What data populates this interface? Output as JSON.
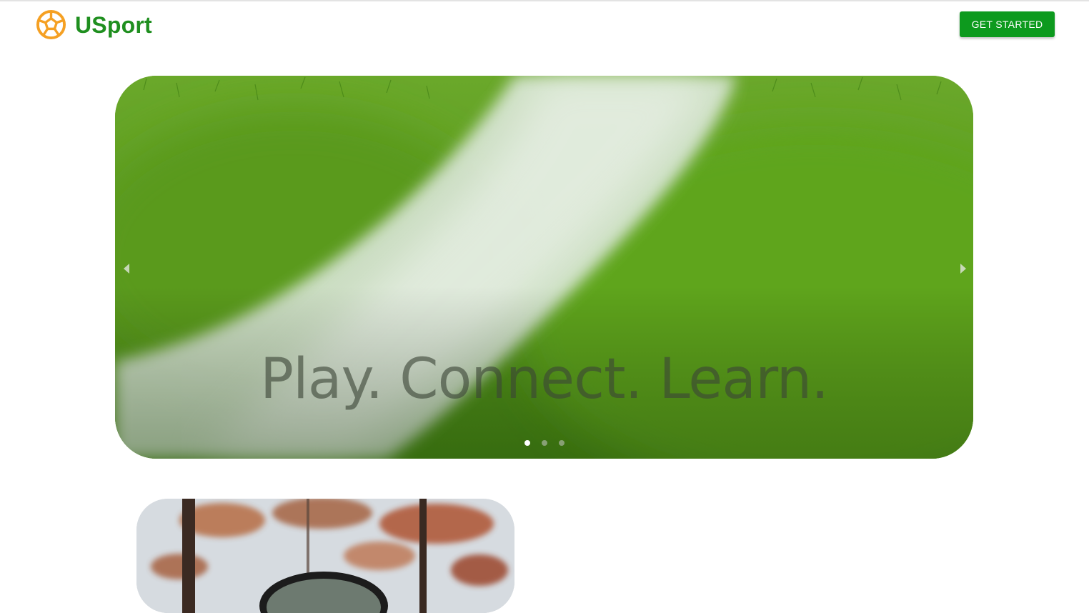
{
  "brand": {
    "name": "USport",
    "logo_icon": "soccer-ball-icon",
    "logo_color": "#f5a023",
    "text_color": "#1f8f1f"
  },
  "header": {
    "cta_label": "GET STARTED",
    "cta_color": "#0d9a1e"
  },
  "hero": {
    "caption": "Play. Connect. Learn.",
    "prev_icon": "chevron-left-icon",
    "next_icon": "chevron-right-icon",
    "slides": 3,
    "active_slide": 1
  },
  "colors": {
    "grass": "#4f9016",
    "line_white": "#e8f0e8"
  }
}
